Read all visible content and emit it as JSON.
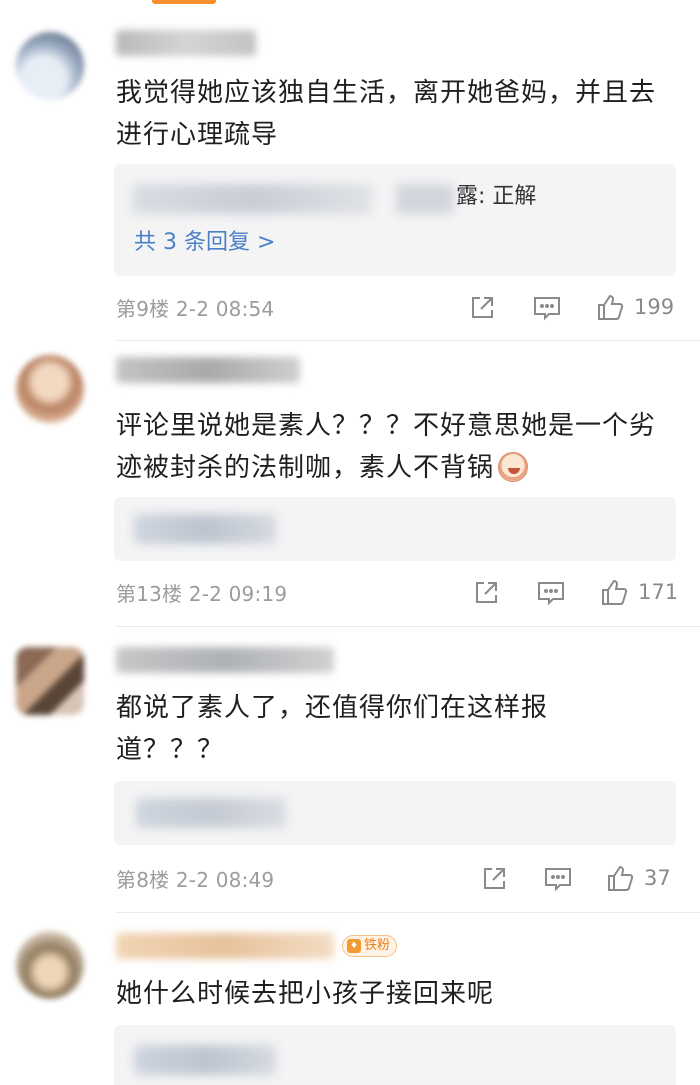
{
  "comments": [
    {
      "text": "我觉得她应该独自生活，离开她爸妈，并且去进行心理疏导",
      "reply_snippet": "露: 正解",
      "reply_more": "共 3 条回复 >",
      "meta": "第9楼  2-2 08:54",
      "likes": "199"
    },
    {
      "text": "评论里说她是素人？？？不好意思她是一个劣迹被封杀的法制咖，素人不背锅",
      "meta": "第13楼  2-2 09:19",
      "likes": "171"
    },
    {
      "text": "都说了素人了，还值得你们在这样报道？？？",
      "meta": "第8楼  2-2 08:49",
      "likes": "37"
    },
    {
      "text": "她什么时候去把小孩子接回来呢",
      "badge": "铁粉"
    }
  ],
  "icons": {
    "share": "share-icon",
    "comment": "comment-icon",
    "like": "thumbs-up-icon"
  },
  "colors": {
    "accent": "#f78f2e",
    "link": "#4b7fc8",
    "meta": "#9c9c9c"
  }
}
